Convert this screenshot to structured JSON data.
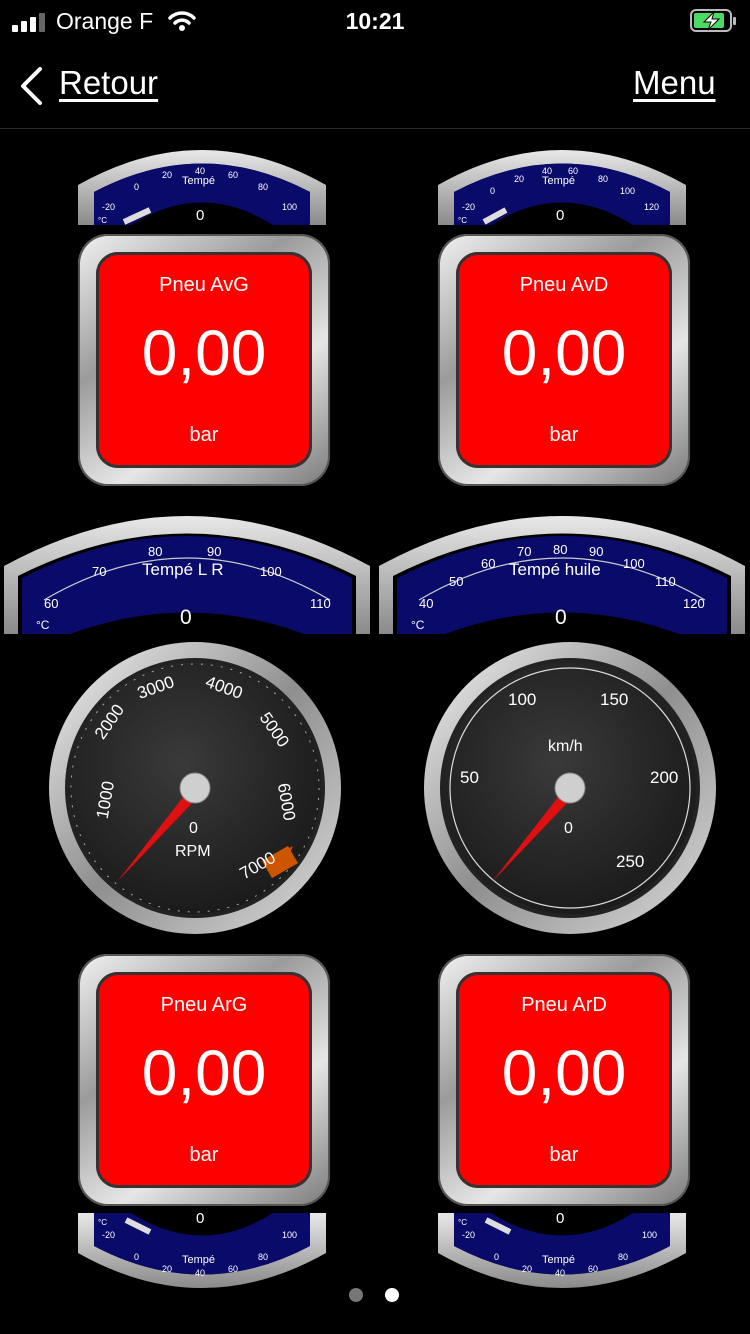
{
  "status": {
    "carrier": "Orange F",
    "time": "10:21"
  },
  "nav": {
    "back_label": "Retour",
    "menu_label": "Menu"
  },
  "colors": {
    "tile_red": "#ff0000",
    "dial_blue": "#0a0a6a",
    "needle_red": "#e01010",
    "battery_green": "#4cd964"
  },
  "small_temp_gauges": [
    {
      "label": "Tempé",
      "unit": "°C",
      "value": "0",
      "ticks": [
        "-20",
        "0",
        "20",
        "40",
        "60",
        "80",
        "100"
      ]
    },
    {
      "label": "Tempé",
      "unit": "°C",
      "value": "0",
      "ticks": [
        "-20",
        "0",
        "20",
        "40",
        "60",
        "80",
        "100",
        "120"
      ]
    },
    {
      "label": "Tempé",
      "unit": "°C",
      "value": "0",
      "ticks": [
        "-20",
        "0",
        "20",
        "40",
        "60",
        "80",
        "100"
      ]
    },
    {
      "label": "Tempé",
      "unit": "°C",
      "value": "0",
      "ticks": [
        "-20",
        "0",
        "20",
        "40",
        "60",
        "80",
        "100"
      ]
    }
  ],
  "tiles": [
    {
      "label": "Pneu AvG",
      "value": "0,00",
      "unit": "bar"
    },
    {
      "label": "Pneu AvD",
      "value": "0,00",
      "unit": "bar"
    },
    {
      "label": "Pneu ArG",
      "value": "0,00",
      "unit": "bar"
    },
    {
      "label": "Pneu ArD",
      "value": "0,00",
      "unit": "bar"
    }
  ],
  "large_temp_gauges": [
    {
      "label": "Tempé L R",
      "unit": "°C",
      "value": "0",
      "ticks": [
        "60",
        "70",
        "80",
        "90",
        "100",
        "110"
      ]
    },
    {
      "label": "Tempé huile",
      "unit": "°C",
      "value": "0",
      "ticks": [
        "40",
        "50",
        "60",
        "70",
        "80",
        "90",
        "100",
        "110",
        "120"
      ]
    }
  ],
  "rpm_gauge": {
    "unit": "RPM",
    "value": "0",
    "ticks": [
      "1000",
      "2000",
      "3000",
      "4000",
      "5000",
      "6000",
      "7000"
    ]
  },
  "speed_gauge": {
    "unit": "km/h",
    "value": "0",
    "ticks": [
      "50",
      "100",
      "150",
      "200",
      "250"
    ]
  },
  "pager": {
    "pages": 2,
    "active_index": 1
  }
}
